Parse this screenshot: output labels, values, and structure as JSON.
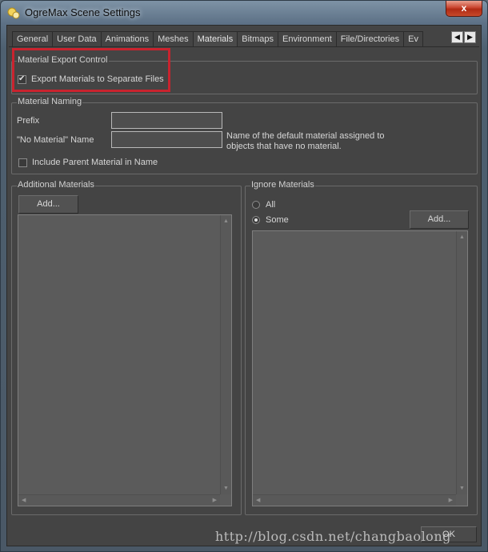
{
  "window": {
    "title": "OgreMax Scene Settings",
    "close_glyph": "x"
  },
  "tabs": [
    {
      "label": "General"
    },
    {
      "label": "User Data"
    },
    {
      "label": "Animations"
    },
    {
      "label": "Meshes"
    },
    {
      "label": "Materials",
      "active": true
    },
    {
      "label": "Bitmaps"
    },
    {
      "label": "Environment"
    },
    {
      "label": "File/Directories"
    },
    {
      "label": "Ev"
    }
  ],
  "tab_scroll": {
    "left_glyph": "◀",
    "right_glyph": "▶"
  },
  "export_control": {
    "legend": "Material Export Control",
    "export_separate": {
      "label": "Export Materials to Separate Files",
      "checked": true,
      "check_glyph": "✔"
    }
  },
  "naming": {
    "legend": "Material Naming",
    "prefix_label": "Prefix",
    "prefix_value": "",
    "no_material_label": "\"No Material\" Name",
    "no_material_value": "",
    "no_material_hint_line1": "Name of the default material assigned to",
    "no_material_hint_line2": "objects that have no material.",
    "include_parent": {
      "label": "Include Parent Material in Name",
      "checked": false
    }
  },
  "additional": {
    "legend": "Additional Materials",
    "add_label": "Add..."
  },
  "ignore": {
    "legend": "Ignore Materials",
    "option_all": "All",
    "option_some": "Some",
    "selected": "Some",
    "add_label": "Add..."
  },
  "scroll_glyphs": {
    "up": "▲",
    "down": "▼",
    "left": "◀",
    "right": "▶"
  },
  "footer": {
    "ok_label": "OK"
  },
  "watermark": "http://blog.csdn.net/changbaolong",
  "colors": {
    "highlight": "#c9232e",
    "panel": "#444444",
    "list_bg": "#5b5b5b"
  }
}
